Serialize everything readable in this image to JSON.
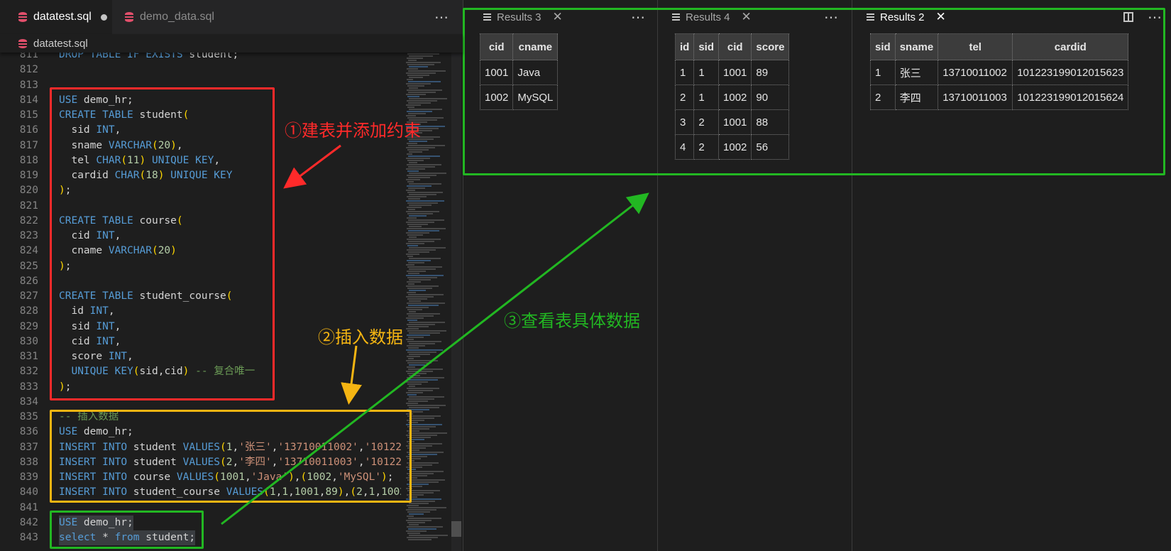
{
  "editor": {
    "tabs": [
      {
        "label": "datatest.sql",
        "modified": true
      },
      {
        "label": "demo_data.sql",
        "modified": false
      }
    ],
    "breadcrumb": "datatest.sql",
    "more_icon": "⋯"
  },
  "code_lines": [
    {
      "n": "811",
      "t": "DROP TABLE IF EXISTS student;"
    },
    {
      "n": "812",
      "t": ""
    },
    {
      "n": "813",
      "t": ""
    },
    {
      "n": "814",
      "t": "USE demo_hr;"
    },
    {
      "n": "815",
      "t": "CREATE TABLE student("
    },
    {
      "n": "816",
      "t": "  sid INT,"
    },
    {
      "n": "817",
      "t": "  sname VARCHAR(20),"
    },
    {
      "n": "818",
      "t": "  tel CHAR(11) UNIQUE KEY,"
    },
    {
      "n": "819",
      "t": "  cardid CHAR(18) UNIQUE KEY"
    },
    {
      "n": "820",
      "t": ");"
    },
    {
      "n": "821",
      "t": ""
    },
    {
      "n": "822",
      "t": "CREATE TABLE course("
    },
    {
      "n": "823",
      "t": "  cid INT,"
    },
    {
      "n": "824",
      "t": "  cname VARCHAR(20)"
    },
    {
      "n": "825",
      "t": ");"
    },
    {
      "n": "826",
      "t": ""
    },
    {
      "n": "827",
      "t": "CREATE TABLE student_course("
    },
    {
      "n": "828",
      "t": "  id INT,"
    },
    {
      "n": "829",
      "t": "  sid INT,"
    },
    {
      "n": "830",
      "t": "  cid INT,"
    },
    {
      "n": "831",
      "t": "  score INT,"
    },
    {
      "n": "832",
      "t": "  UNIQUE KEY(sid,cid) -- 复合唯一"
    },
    {
      "n": "833",
      "t": ");"
    },
    {
      "n": "834",
      "t": ""
    },
    {
      "n": "835",
      "t": "-- 插入数据"
    },
    {
      "n": "836",
      "t": "USE demo_hr;"
    },
    {
      "n": "837",
      "t": "INSERT INTO student VALUES(1,'张三','13710011002','10122"
    },
    {
      "n": "838",
      "t": "INSERT INTO student VALUES(2,'李四','13710011003','10122"
    },
    {
      "n": "839",
      "t": "INSERT INTO course VALUES(1001,'Java'),(1002,'MySQL');"
    },
    {
      "n": "840",
      "t": "INSERT INTO student_course VALUES(1,1,1001,89),(2,1,1002"
    },
    {
      "n": "841",
      "t": ""
    },
    {
      "n": "842",
      "t": "USE demo_hr;",
      "selected": true
    },
    {
      "n": "843",
      "t": "select * from student;",
      "selected": true
    }
  ],
  "results": [
    {
      "title": "Results 3",
      "active": false,
      "close_icon": "✕",
      "more_icon": "⋯",
      "columns": [
        "cid",
        "cname"
      ],
      "rows": [
        [
          "1001",
          "Java"
        ],
        [
          "1002",
          "MySQL"
        ]
      ]
    },
    {
      "title": "Results 4",
      "active": false,
      "close_icon": "✕",
      "more_icon": "⋯",
      "columns": [
        "id",
        "sid",
        "cid",
        "score"
      ],
      "rows": [
        [
          "1",
          "1",
          "1001",
          "89"
        ],
        [
          "2",
          "1",
          "1002",
          "90"
        ],
        [
          "3",
          "2",
          "1001",
          "88"
        ],
        [
          "4",
          "2",
          "1002",
          "56"
        ]
      ]
    },
    {
      "title": "Results 2",
      "active": true,
      "close_icon": "✕",
      "more_icon": "⋯",
      "split_icon": "split-editor-icon",
      "columns": [
        "sid",
        "sname",
        "tel",
        "cardid"
      ],
      "rows": [
        [
          "1",
          "张三",
          "13710011002",
          "101223199012015623"
        ],
        [
          "2",
          "李四",
          "13710011003",
          "101223199012015624"
        ]
      ]
    }
  ],
  "annotations": {
    "step1": {
      "text": "①建表并添加约束",
      "color": "#ff2a2a"
    },
    "step2": {
      "text": "②插入数据",
      "color": "#f5b512"
    },
    "step3": {
      "text": "③查看表具体数据",
      "color": "#22b722"
    }
  }
}
